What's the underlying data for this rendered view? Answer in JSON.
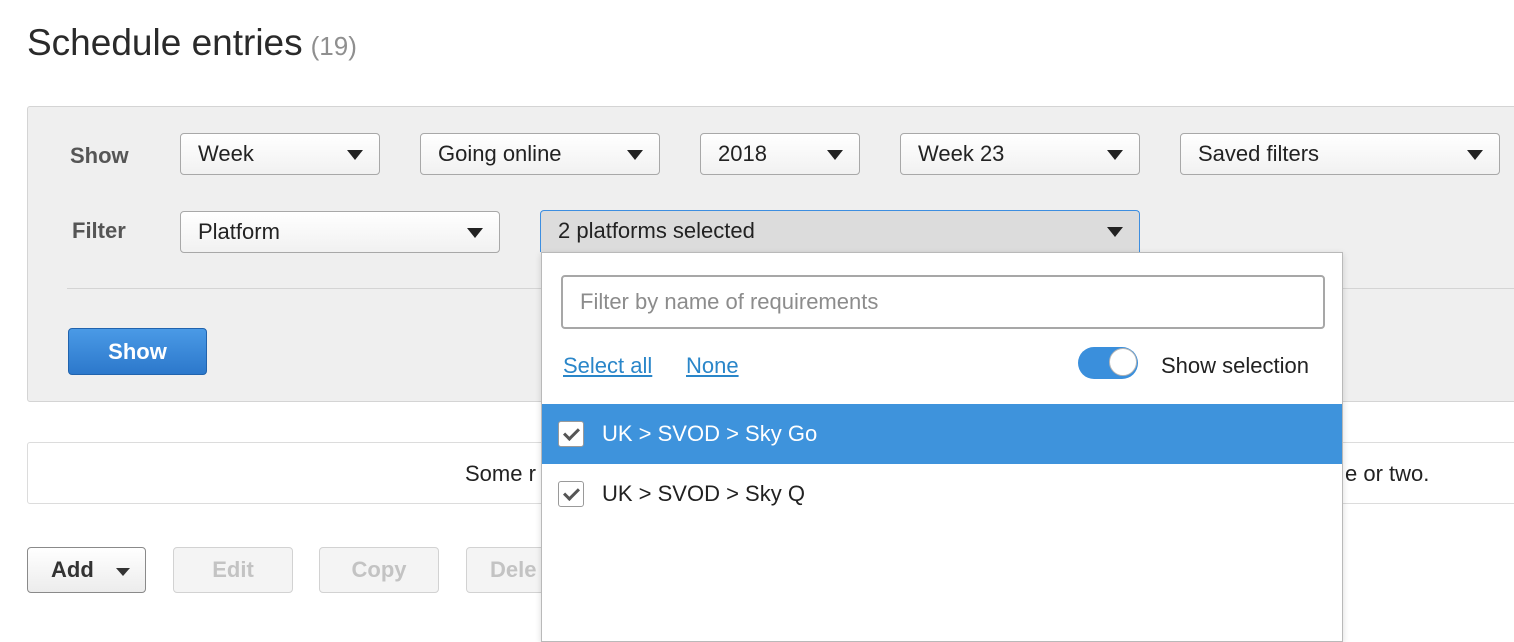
{
  "page": {
    "title": "Schedule entries",
    "count": "(19)"
  },
  "filters": {
    "show_label": "Show",
    "filter_label": "Filter",
    "period": "Week",
    "event": "Going online",
    "year": "2018",
    "week": "Week 23",
    "saved_filters": "Saved filters",
    "filter_by": "Platform",
    "platforms": "2 platforms selected",
    "show_button": "Show"
  },
  "info": {
    "left_text": "Some r",
    "right_text": "e or two."
  },
  "toolbar": {
    "add": "Add",
    "edit": "Edit",
    "copy": "Copy",
    "delete": "Dele"
  },
  "dropdown": {
    "search_placeholder": "Filter by name of requirements",
    "select_all": "Select all",
    "none": "None",
    "show_selection_label": "Show selection",
    "show_selection_on": true,
    "items": [
      {
        "label": "UK > SVOD > Sky Go",
        "checked": true,
        "highlighted": true
      },
      {
        "label": "UK > SVOD > Sky Q",
        "checked": true,
        "highlighted": false
      }
    ]
  },
  "colors": {
    "primary_button": "#2c78cb",
    "highlight": "#3e93dc",
    "link": "#2a86c9"
  },
  "icons": [
    "caret-down-icon",
    "checkbox-checked-icon",
    "toggle-switch"
  ]
}
